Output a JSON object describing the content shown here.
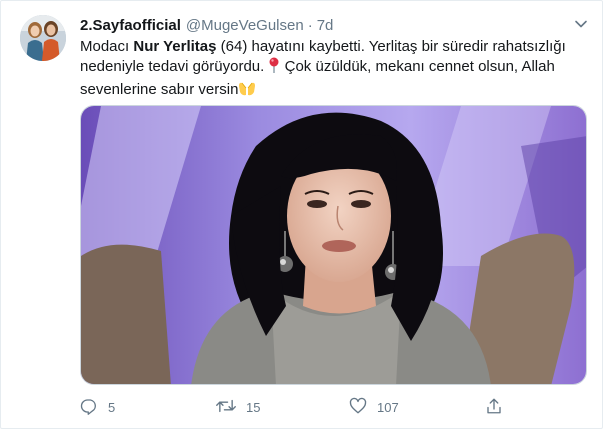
{
  "tweet": {
    "display_name": "2.Sayfaofficial",
    "handle": "@MugeVeGulsen",
    "separator": "·",
    "time": "7d",
    "text_prefix": "Modacı ",
    "text_bold": "Nur Yerlitaş",
    "text_line1_rest": " (64) hayatını kaybetti. Yerlitaş bir süredir rahatsızlığı",
    "text_line2": "nedeniyle tedavi görüyordu. ",
    "text_line2_rest": " Çok üzüldük, mekanı cennet olsun, Allah",
    "text_line3": "sevenlerine sabır versin"
  },
  "actions": {
    "reply_count": "5",
    "retweet_count": "15",
    "like_count": "107"
  },
  "icons": {
    "reply": "reply-icon",
    "retweet": "retweet-icon",
    "like": "heart-icon",
    "share": "share-icon",
    "menu": "chevron-down-icon",
    "pin": "round-pushpin-emoji",
    "hands": "open-hands-emoji"
  },
  "colors": {
    "text": "#14171a",
    "secondary": "#657786",
    "border": "#e6ecf0"
  }
}
